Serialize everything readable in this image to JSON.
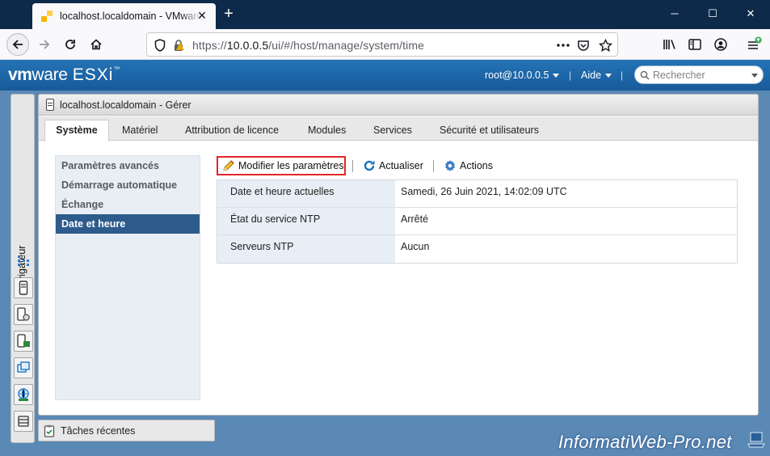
{
  "browser": {
    "tab_title": "localhost.localdomain - VMware ESXi",
    "url_prefix": "https://",
    "url_host": "10.0.0.5",
    "url_path": "/ui/#/host/manage/system/time",
    "new_tab_symbol": "+",
    "tab_close_symbol": "✕",
    "window_buttons": {
      "minimize": "─",
      "maximize": "☐",
      "close": "✕"
    }
  },
  "esxi_header": {
    "logo_vm": "vm",
    "logo_ware": "ware",
    "logo_esxi": "ESXi",
    "logo_tm": "™",
    "user": "root@10.0.0.5",
    "help": "Aide",
    "separator": "|",
    "search_placeholder": "Rechercher"
  },
  "navigator": {
    "label": "Navigateur"
  },
  "panel": {
    "title": "localhost.localdomain - Gérer",
    "tabs": [
      "Système",
      "Matériel",
      "Attribution de licence",
      "Modules",
      "Services",
      "Sécurité et utilisateurs"
    ],
    "active_tab": "Système",
    "subnav": [
      "Paramètres avancés",
      "Démarrage automatique",
      "Échange",
      "Date et heure"
    ],
    "active_subnav": "Date et heure",
    "toolbar": {
      "edit_label": "Modifier les paramètres",
      "refresh_label": "Actualiser",
      "actions_label": "Actions"
    },
    "info_rows": [
      {
        "key": "Date et heure actuelles",
        "value": "Samedi, 26 Juin 2021, 14:02:09 UTC"
      },
      {
        "key": "État du service NTP",
        "value": "Arrêté"
      },
      {
        "key": "Serveurs NTP",
        "value": "Aucun"
      }
    ]
  },
  "recent_tasks": {
    "label": "Tâches récentes"
  },
  "watermark": "InformatiWeb-Pro.net",
  "colors": {
    "browser_titlebar": "#0d2a4a",
    "esxi_header": "#1e66aa",
    "app_background": "#5b89b5",
    "active_subnav": "#2d5b8c",
    "edit_highlight": "#e3262b"
  },
  "icons": {
    "favicon": "vmware-favicon-icon",
    "back": "arrow-left-icon",
    "forward": "arrow-right-icon",
    "reload": "reload-icon",
    "home": "home-icon",
    "shield": "shield-icon",
    "lock": "lock-icon",
    "more": "ellipsis-icon",
    "pocket": "pocket-icon",
    "bookmark": "star-icon",
    "library": "library-icon",
    "sidebar": "sidebar-icon",
    "account": "account-icon",
    "menu": "hamburger-menu-icon"
  }
}
